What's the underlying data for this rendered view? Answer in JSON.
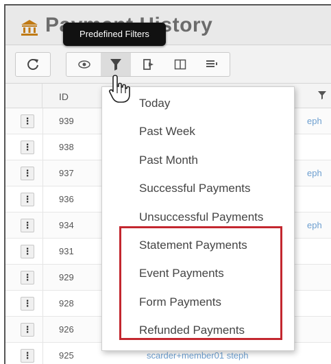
{
  "title": {
    "text": "Payment History",
    "icon": "bank-icon"
  },
  "tooltip": {
    "text": "Predefined Filters"
  },
  "toolbar": {
    "buttons": [
      {
        "name": "refresh-icon"
      },
      {
        "name": "eye-icon"
      },
      {
        "name": "funnel-icon"
      },
      {
        "name": "export-icon"
      },
      {
        "name": "columns-icon"
      },
      {
        "name": "list-icon"
      }
    ]
  },
  "grid": {
    "header": {
      "id_label": "ID"
    },
    "rows": [
      {
        "id": "939",
        "user": "eph"
      },
      {
        "id": "938",
        "user": ""
      },
      {
        "id": "937",
        "user": "eph"
      },
      {
        "id": "936",
        "user": ""
      },
      {
        "id": "934",
        "user": "eph"
      },
      {
        "id": "931",
        "user": ""
      },
      {
        "id": "929",
        "user": ""
      },
      {
        "id": "928",
        "user": ""
      },
      {
        "id": "926",
        "user": ""
      },
      {
        "id": "925",
        "user": "scarder+member01 steph"
      }
    ]
  },
  "menu": {
    "items": [
      "Today",
      "Past Week",
      "Past Month",
      "Successful Payments",
      "Unsuccessful Payments",
      "Statement Payments",
      "Event Payments",
      "Form Payments",
      "Refunded Payments"
    ]
  },
  "colors": {
    "highlight": "#c3272f",
    "title_icon": "#c07a14",
    "link": "#6d9fd0"
  }
}
